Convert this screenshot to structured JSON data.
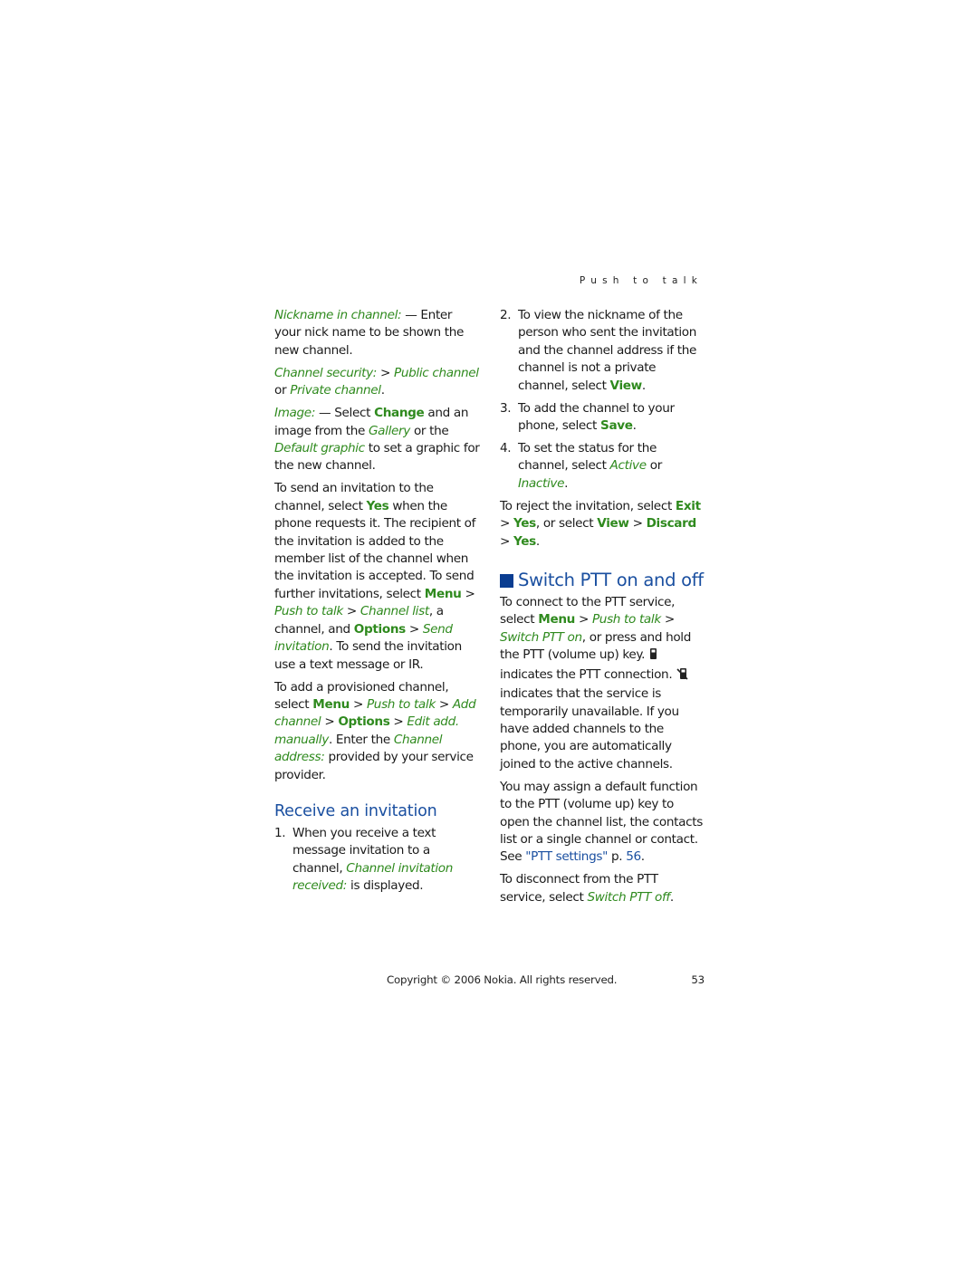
{
  "header": {
    "section_title": "Push to talk"
  },
  "left_column": {
    "nickname_item": {
      "term": "Nickname in channel:",
      "text": " — Enter your nick name to be shown the new channel."
    },
    "security_item": {
      "term": "Channel security:",
      "sep": " > ",
      "option1": "Public channel",
      "or": " or ",
      "option2": "Private channel",
      "end": "."
    },
    "image_item": {
      "term": "Image:",
      "t1": " — Select ",
      "change": "Change",
      "t2": " and an image from the ",
      "gallery": "Gallery",
      "t3": " or the ",
      "default_graphic": "Default graphic",
      "t4": " to set a graphic for the new channel."
    },
    "invitation_para": {
      "t1": "To send an invitation to the channel, select ",
      "yes": "Yes",
      "t2": " when the phone requests it. The recipient of the invitation is added to the member list of the channel when the invitation is accepted. To send further invitations, select ",
      "menu": "Menu",
      "gt1": " > ",
      "push_to_talk": "Push to talk",
      "gt2": " > ",
      "channel_list": "Channel list",
      "t3": ", a channel, and ",
      "options": "Options",
      "gt3": " > ",
      "send_invitation": "Send invitation",
      "t4": ". To send the invitation use a text message or IR."
    },
    "provisioned_para": {
      "t1": "To add a provisioned channel, select ",
      "menu": "Menu",
      "gt1": " > ",
      "push_to_talk": "Push to talk",
      "gt2": " > ",
      "add_channel": "Add channel",
      "gt3": " > ",
      "options": "Options",
      "gt4": " > ",
      "edit_add_manually": "Edit add. manually",
      "t2": ". Enter the ",
      "channel_address": "Channel address:",
      "t3": " provided by your service provider."
    },
    "receive_heading": "Receive an invitation",
    "step1": {
      "num": "1.",
      "t1": "When you receive a text message invitation to a channel, ",
      "term": "Channel invitation received:",
      "t2": " is displayed."
    }
  },
  "right_column": {
    "step2": {
      "num": "2.",
      "t1": "To view the nickname of the person who sent the invitation and the channel address if the channel is not a private channel, select ",
      "view": "View",
      "end": "."
    },
    "step3": {
      "num": "3.",
      "t1": "To add the channel to your phone, select ",
      "save": "Save",
      "end": "."
    },
    "step4": {
      "num": "4.",
      "t1": "To set the status for the channel, select ",
      "active": "Active",
      "or": " or ",
      "inactive": "Inactive",
      "end": "."
    },
    "reject_para": {
      "t1": "To reject the invitation, select ",
      "exit": "Exit",
      "gt1": " > ",
      "yes1": "Yes",
      "t2": ", or select ",
      "view": "View",
      "gt2": " > ",
      "discard": "Discard",
      "gt3": " > ",
      "yes2": "Yes",
      "end": "."
    },
    "switch_heading": "Switch PTT on and off",
    "connect_para": {
      "t1": "To connect to the PTT service, select ",
      "menu": "Menu",
      "gt1": " > ",
      "push_to_talk": "Push to talk",
      "gt2": " > ",
      "switch_on": "Switch PTT on",
      "t2": ", or press and hold the PTT (volume up) key.",
      "icon1": "ptt-connected-icon",
      "t3": "indicates the PTT connection.",
      "icon2": "ptt-unavailable-icon",
      "t4": "indicates that the service is temporarily unavailable. If you have added channels to the phone, you are automatically joined to the active channels."
    },
    "assign_para": {
      "t1": "You may assign a default function to the PTT (volume up) key to open the channel list, the contacts list or a single channel or contact. See ",
      "link": "\"PTT settings\"",
      "t2": " p. ",
      "page_link": "56",
      "end": "."
    },
    "disconnect_para": {
      "t1": "To disconnect from the PTT service, select ",
      "switch_off": "Switch PTT off",
      "end": "."
    }
  },
  "footer": {
    "copyright": "Copyright © 2006 Nokia. All rights reserved.",
    "page_number": "53"
  },
  "colors": {
    "ui_green": "#2f8a1e",
    "heading_blue": "#1a4fa0",
    "bullet_blue": "#0a3d91"
  }
}
